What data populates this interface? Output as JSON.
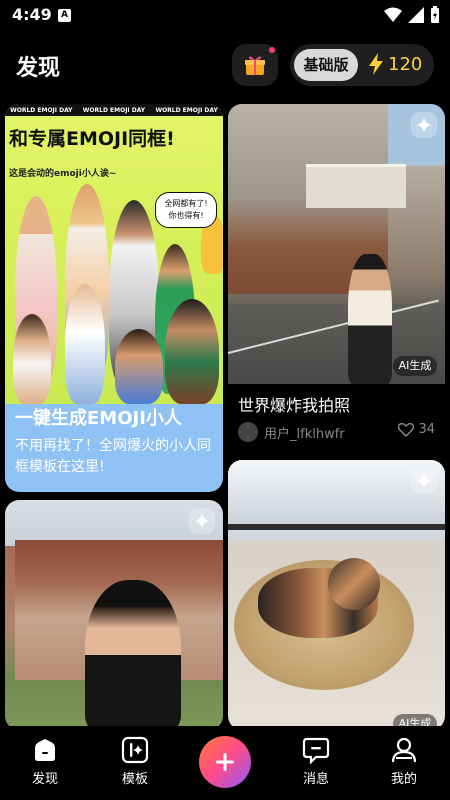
{
  "status_bar": {
    "time": "4:49",
    "app_badge": "A"
  },
  "header": {
    "title": "发现",
    "plan_label": "基础版",
    "credits": "120"
  },
  "feed": {
    "emoji_card": {
      "strip_text": [
        "WORLD EMOJI DAY",
        "WORLD EMOJI DAY",
        "WORLD EMOJI DAY"
      ],
      "headline": "和专属EMOJI同框!",
      "subheadline": "这是会动的emoji小人诶~",
      "bubble_line1": "全网都有了!",
      "bubble_line2": "你也得有!",
      "title": "一键生成EMOJI小人",
      "description": "不用再找了！全网爆火的小人同框模板在这里!"
    },
    "street_card": {
      "ai_tag": "AI生成",
      "caption": "世界爆炸我拍照",
      "username": "用户_lfklhwfr",
      "likes": "34"
    },
    "grad_card": {},
    "cat_card": {
      "ai_tag": "AI生成"
    }
  },
  "bottom_nav": {
    "items": [
      {
        "label": "发现",
        "icon": "home-icon"
      },
      {
        "label": "模板",
        "icon": "template-icon"
      },
      {
        "label": "消息",
        "icon": "message-icon"
      },
      {
        "label": "我的",
        "icon": "profile-icon"
      }
    ],
    "add_icon": "plus-icon"
  },
  "colors": {
    "accent": "#ffd13a",
    "gift_dot": "#ff3b6b",
    "emoji_card_bg": "#8ec1f4"
  }
}
